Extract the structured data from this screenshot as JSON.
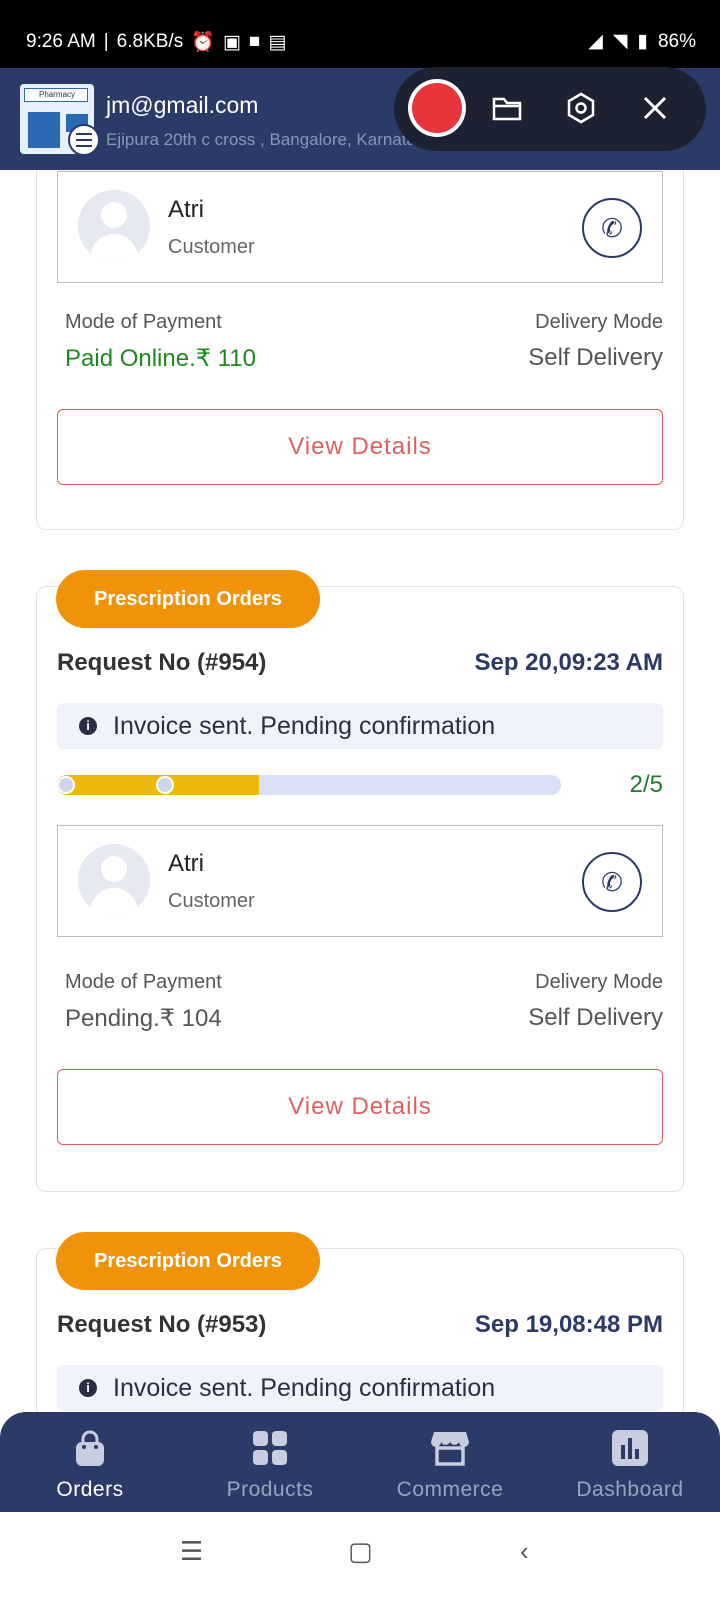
{
  "status_bar": {
    "time": "9:26 AM",
    "speed": "6.8KB/s",
    "battery": "86%"
  },
  "header": {
    "email": "jm@gmail.com",
    "address": "Ejipura 20th c cross , Bangalore, Karnataka, 560047",
    "logo_text": "Pharmacy"
  },
  "orders": [
    {
      "customer_name": "Atri",
      "customer_role": "Customer",
      "payment_label": "Mode of Payment",
      "payment_value": "Paid Online.₹ 110",
      "delivery_label": "Delivery Mode",
      "delivery_value": "Self Delivery",
      "button": "View Details"
    },
    {
      "badge": "Prescription Orders",
      "request": "Request No (#954)",
      "date": "Sep 20,09:23 AM",
      "status": "Invoice sent. Pending confirmation",
      "progress_step": "2/5",
      "progress_fraction": 0.4,
      "customer_name": "Atri",
      "customer_role": "Customer",
      "payment_label": "Mode of Payment",
      "payment_value": "Pending.₹ 104",
      "delivery_label": "Delivery Mode",
      "delivery_value": "Self Delivery",
      "button": "View Details"
    },
    {
      "badge": "Prescription Orders",
      "request": "Request No (#953)",
      "date": "Sep 19,08:48 PM",
      "status": "Invoice sent. Pending confirmation"
    }
  ],
  "bottom_nav": [
    {
      "label": "Orders",
      "icon": "shopping-bag-icon",
      "active": true
    },
    {
      "label": "Products",
      "icon": "grid-icon",
      "active": false
    },
    {
      "label": "Commerce",
      "icon": "storefront-icon",
      "active": false
    },
    {
      "label": "Dashboard",
      "icon": "bar-chart-icon",
      "active": false
    }
  ],
  "colors": {
    "primary": "#2b3a67",
    "badge": "#f0930a",
    "progress_fill": "#ecb90e",
    "paid": "#1d8a1d",
    "button_border": "#e05a5a",
    "record": "#e8343b"
  }
}
